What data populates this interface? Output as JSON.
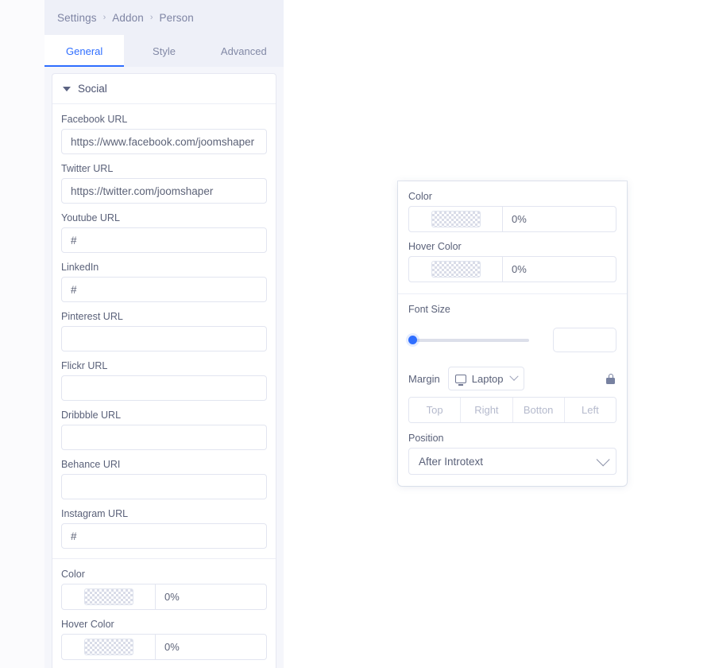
{
  "breadcrumb": {
    "items": [
      "Settings",
      "Addon",
      "Person"
    ],
    "separator": "›"
  },
  "tabs": [
    {
      "label": "General",
      "active": true
    },
    {
      "label": "Style",
      "active": false
    },
    {
      "label": "Advanced",
      "active": false
    }
  ],
  "section": {
    "title": "Social",
    "expanded": true,
    "toggle_icon": "triangle-down-icon"
  },
  "social_fields": [
    {
      "label": "Facebook URL",
      "value": "https://www.facebook.com/joomshaper",
      "placeholder": ""
    },
    {
      "label": "Twitter URL",
      "value": "https://twitter.com/joomshaper",
      "placeholder": ""
    },
    {
      "label": "Youtube URL",
      "value": "#",
      "placeholder": ""
    },
    {
      "label": "LinkedIn",
      "value": "#",
      "placeholder": ""
    },
    {
      "label": "Pinterest URL",
      "value": "",
      "placeholder": ""
    },
    {
      "label": "Flickr URL",
      "value": "",
      "placeholder": ""
    },
    {
      "label": "Dribbble URL",
      "value": "",
      "placeholder": ""
    },
    {
      "label": "Behance URI",
      "value": "",
      "placeholder": ""
    },
    {
      "label": "Instagram URL",
      "value": "#",
      "placeholder": ""
    }
  ],
  "left_colors": [
    {
      "label": "Color",
      "swatch": "transparent-checkerboard",
      "opacity": "0%"
    },
    {
      "label": "Hover Color",
      "swatch": "transparent-checkerboard",
      "opacity": "0%"
    }
  ],
  "style_panel": {
    "colors": [
      {
        "label": "Color",
        "swatch": "transparent-checkerboard",
        "opacity": "0%"
      },
      {
        "label": "Hover Color",
        "swatch": "transparent-checkerboard",
        "opacity": "0%"
      }
    ],
    "font_size": {
      "label": "Font Size",
      "value": "",
      "placeholder": "",
      "slider_percent": 0
    },
    "margin": {
      "label": "Margin",
      "device": "Laptop",
      "device_icon": "monitor-icon",
      "dropdown_icon": "chevron-down-icon",
      "lock_icon": "lock-closed-icon",
      "inputs": [
        {
          "placeholder": "Top",
          "value": ""
        },
        {
          "placeholder": "Right",
          "value": ""
        },
        {
          "placeholder": "Botton",
          "value": ""
        },
        {
          "placeholder": "Left",
          "value": ""
        }
      ]
    },
    "position": {
      "label": "Position",
      "value": "After Introtext",
      "dropdown_icon": "chevron-down-icon"
    }
  },
  "colors": {
    "accent": "#2f6eff",
    "panel_bg": "#f5f6fb",
    "header_bg": "#eef0f8",
    "border": "#e2e5f0",
    "text": "#5a6179",
    "muted": "#b7bcd0"
  }
}
